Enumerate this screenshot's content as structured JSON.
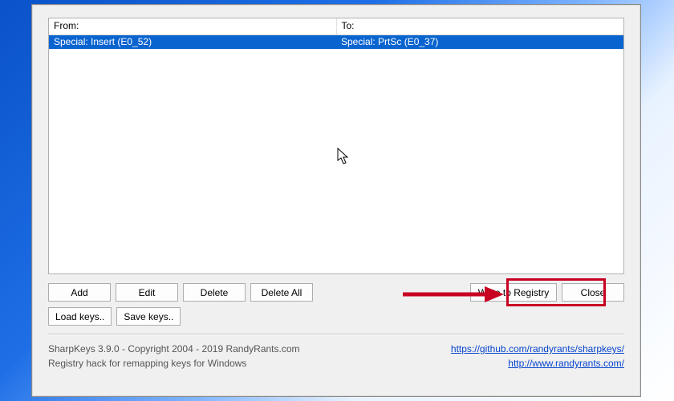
{
  "list": {
    "headers": {
      "from": "From:",
      "to": "To:"
    },
    "rows": [
      {
        "from": "Special: Insert (E0_52)",
        "to": "Special: PrtSc (E0_37)"
      }
    ]
  },
  "buttons": {
    "add": "Add",
    "edit": "Edit",
    "delete": "Delete",
    "delete_all": "Delete All",
    "write": "Write to Registry",
    "close": "Close",
    "load": "Load keys..",
    "save": "Save keys.."
  },
  "footer": {
    "line1": "SharpKeys 3.9.0 - Copyright 2004 - 2019 RandyRants.com",
    "line2": "Registry hack for remapping keys for Windows",
    "link1": "https://github.com/randyrants/sharpkeys/",
    "link2": "http://www.randyrants.com/"
  }
}
